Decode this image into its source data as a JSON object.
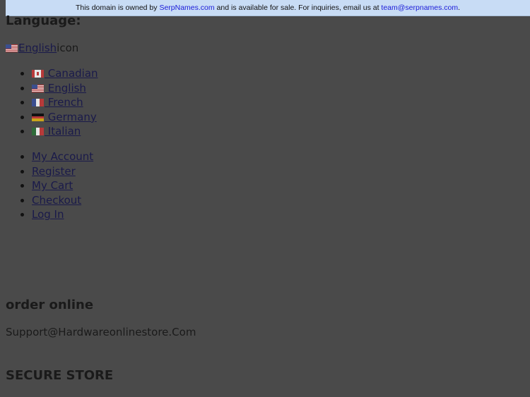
{
  "banner": {
    "text_before": "This domain is owned by ",
    "owner_link": "SerpNames.com",
    "text_middle": " and is available for sale. For inquiries, email us at ",
    "email_link": "team@serpnames.com",
    "text_after": "."
  },
  "language": {
    "heading": "Language:",
    "current_label": "English",
    "current_icon_alt": "icon",
    "options": [
      {
        "label": " Canadian",
        "flag": "canada-flag-icon"
      },
      {
        "label": " English",
        "flag": "us-flag-icon"
      },
      {
        "label": " French",
        "flag": "france-flag-icon"
      },
      {
        "label": " Germany",
        "flag": "germany-flag-icon"
      },
      {
        "label": " Italian",
        "flag": "italy-flag-icon"
      }
    ]
  },
  "account_menu": {
    "items": [
      "My Account",
      "Register",
      "My Cart",
      "Checkout",
      "Log In"
    ]
  },
  "footer": {
    "order_heading": "order online",
    "support_email": "Support@Hardwareonlinestore.Com",
    "secure_heading": "SECURE STORE"
  }
}
